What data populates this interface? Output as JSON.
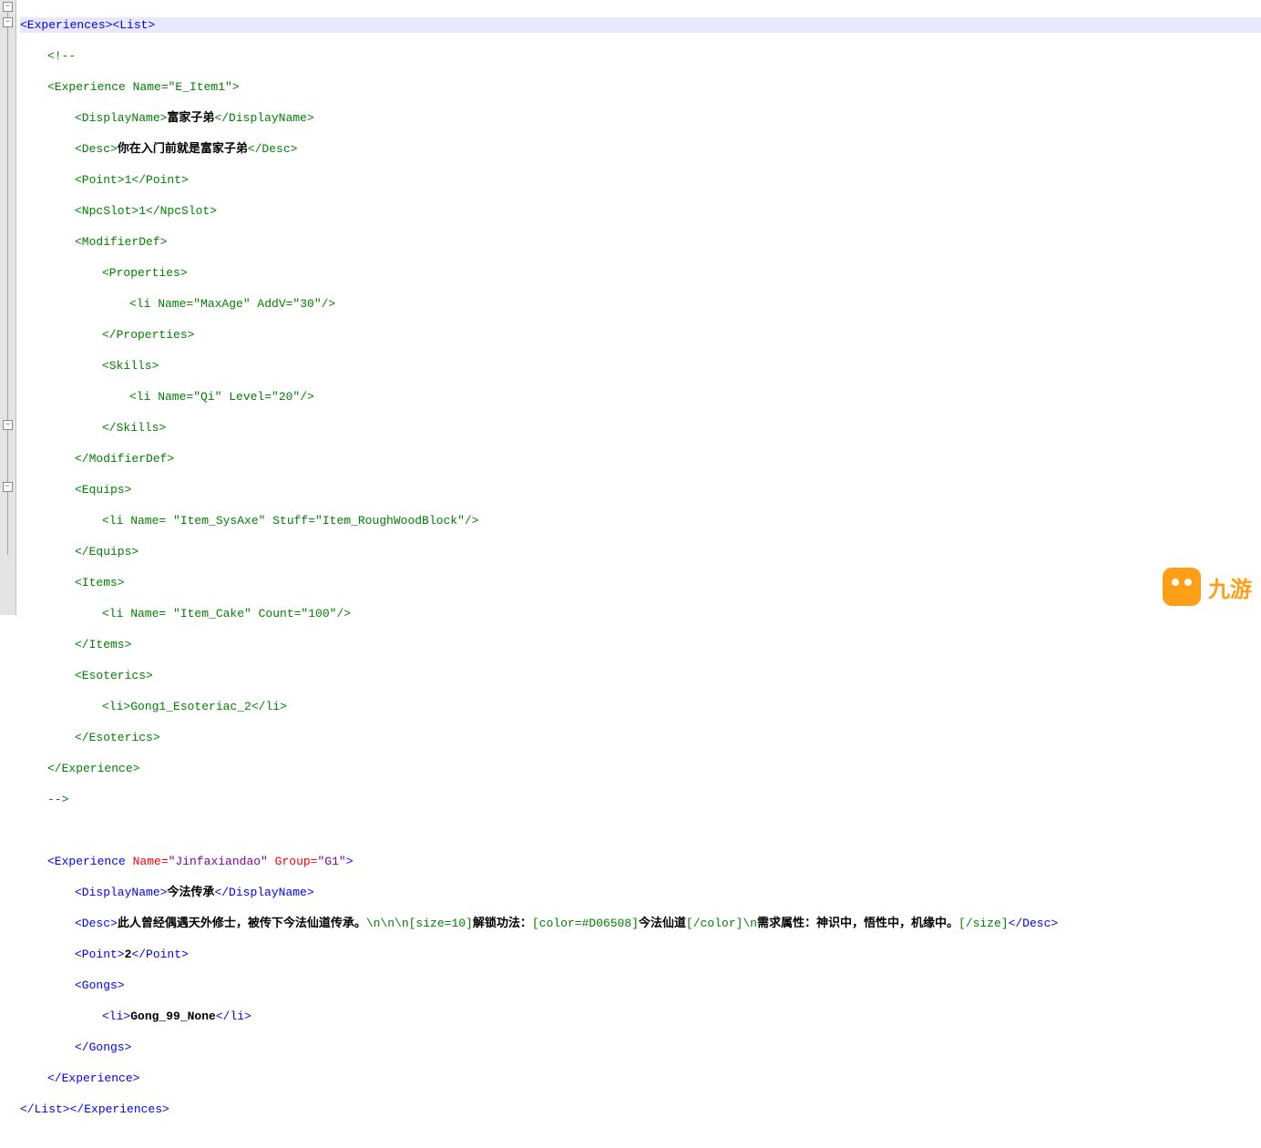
{
  "watermark": {
    "text": "九游"
  },
  "code": {
    "root_open": "<Experiences><List>",
    "comment_open": "<!--",
    "exp1_open": "<Experience Name=\"E_Item1\">",
    "exp1_display_open": "<DisplayName>",
    "exp1_display_text": "富家子弟",
    "exp1_display_close": "</DisplayName>",
    "exp1_desc_open": "<Desc>",
    "exp1_desc_text": "你在入门前就是富家子弟",
    "exp1_desc_close": "</Desc>",
    "exp1_point": "<Point>1</Point>",
    "exp1_npcslot": "<NpcSlot>1</NpcSlot>",
    "exp1_moddef_open": "<ModifierDef>",
    "exp1_props_open": "<Properties>",
    "exp1_props_li": "<li Name=\"MaxAge\" AddV=\"30\"/>",
    "exp1_props_close": "</Properties>",
    "exp1_skills_open": "<Skills>",
    "exp1_skills_li": "<li Name=\"Qi\" Level=\"20\"/>",
    "exp1_skills_close": "</Skills>",
    "exp1_moddef_close": "</ModifierDef>",
    "exp1_equips_open": "<Equips>",
    "exp1_equips_li": "<li Name= \"Item_SysAxe\" Stuff=\"Item_RoughWoodBlock\"/>",
    "exp1_equips_close": "</Equips>",
    "exp1_items_open": "<Items>",
    "exp1_items_li": "<li Name= \"Item_Cake\" Count=\"100\"/>",
    "exp1_items_close": "</Items>",
    "exp1_esoterics_open": "<Esoterics>",
    "exp1_esoterics_li_open": "<li>",
    "exp1_esoterics_li_text": "Gong1_Esoteriac_2",
    "exp1_esoterics_li_close": "</li>",
    "exp1_esoterics_close": "</Esoterics>",
    "exp1_close": "</Experience>",
    "comment_close": "-->",
    "blank": "",
    "exp2_open_pre": "<Experience ",
    "exp2_name_attr": "Name=",
    "exp2_name_val": "\"Jinfaxiandao\"",
    "exp2_group_attr": " Group=",
    "exp2_group_val": "\"G1\"",
    "exp2_open_post": ">",
    "exp2_display_open": "<DisplayName>",
    "exp2_display_text": "今法传承",
    "exp2_display_close": "</DisplayName>",
    "exp2_desc_open": "<Desc>",
    "exp2_desc_text1": "此人曾经偶遇天外修士，被传下今法仙道传承。",
    "exp2_desc_text2": "\\n\\n\\n[size=10]",
    "exp2_desc_text3": "解锁功法：",
    "exp2_desc_text4": "[color=#D06508]",
    "exp2_desc_text5": "今法仙道",
    "exp2_desc_text6": "[/color]",
    "exp2_desc_text7": "\\n",
    "exp2_desc_text8": "需求属性：神识中，悟性中，机缘中。",
    "exp2_desc_text9": "[/size]",
    "exp2_desc_close": "</Desc>",
    "exp2_point_open": "<Point>",
    "exp2_point_text": "2",
    "exp2_point_close": "</Point>",
    "exp2_gongs_open": "<Gongs>",
    "exp2_gongs_li_open": "<li>",
    "exp2_gongs_li_text": "Gong_99_None",
    "exp2_gongs_li_close": "</li>",
    "exp2_gongs_close": "</Gongs>",
    "exp2_close": "</Experience>",
    "root_close": "</List></Experiences>"
  }
}
